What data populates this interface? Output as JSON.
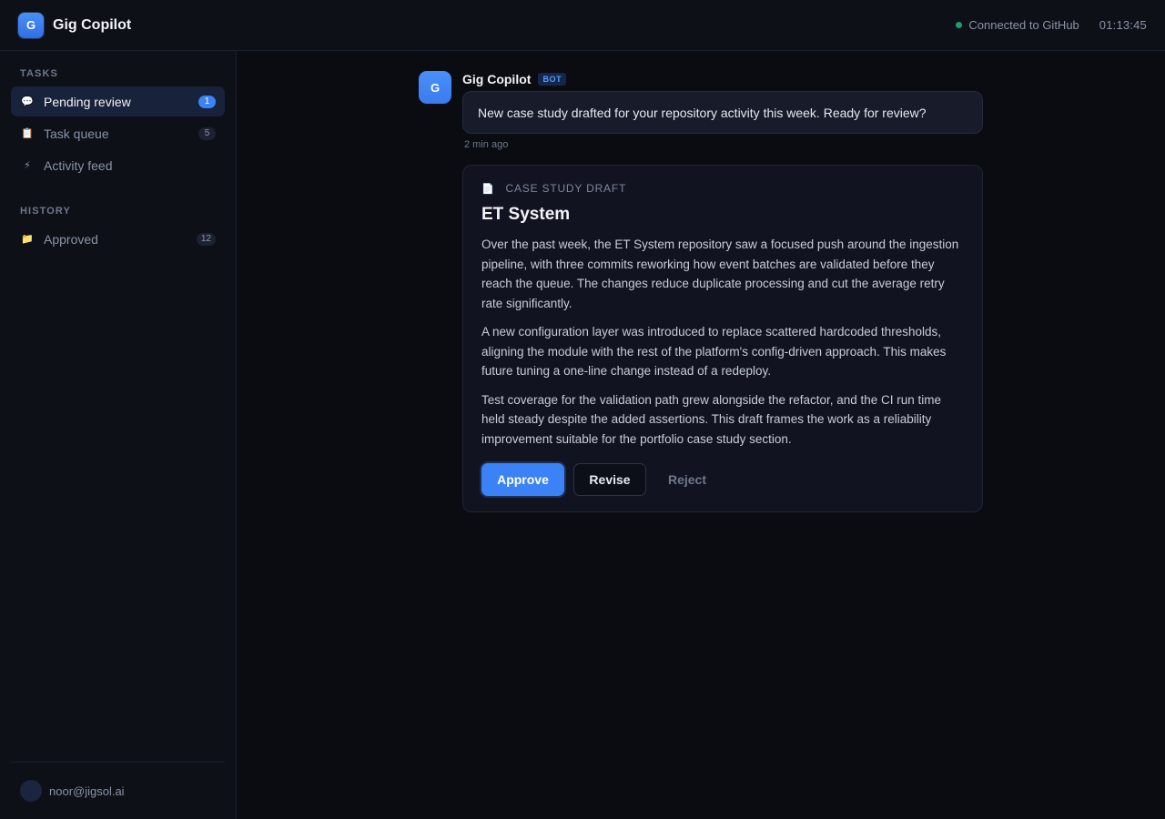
{
  "app": {
    "logo_letter": "G",
    "title": "Gig Copilot",
    "connection_status": "Connected to GitHub",
    "clock": "01:13:45"
  },
  "sidebar": {
    "tasks_label": "TASKS",
    "history_label": "HISTORY",
    "tasks": [
      {
        "icon": "speech-bubble-icon",
        "glyph": "💬",
        "label": "Pending review",
        "count": "1",
        "active": true
      },
      {
        "icon": "clipboard-icon",
        "glyph": "📋",
        "label": "Task queue",
        "count": "5",
        "active": false
      },
      {
        "icon": "lightning-icon",
        "glyph": "⚡",
        "label": "Activity feed",
        "count": null,
        "active": false
      }
    ],
    "history": [
      {
        "icon": "folder-icon",
        "glyph": "📁",
        "label": "Approved",
        "count": "12",
        "active": false
      }
    ],
    "user_email": "noor@jigsol.ai"
  },
  "message": {
    "avatar_letter": "G",
    "sender": "Gig Copilot",
    "badge": "BOT",
    "text": "New case study drafted for your repository activity this week. Ready for review?",
    "time": "2 min ago"
  },
  "draft_card": {
    "kicker": "CASE STUDY DRAFT",
    "title": "ET System",
    "paragraphs": [
      "Over the past week, the ET System repository saw a focused push around the ingestion pipeline, with three commits reworking how event batches are validated before they reach the queue. The changes reduce duplicate processing and cut the average retry rate significantly.",
      "A new configuration layer was introduced to replace scattered hardcoded thresholds, aligning the module with the rest of the platform's config-driven approach. This makes future tuning a one-line change instead of a redeploy.",
      "Test coverage for the validation path grew alongside the refactor, and the CI run time held steady despite the added assertions. This draft frames the work as a reliability improvement suitable for the portfolio case study section."
    ],
    "approve_label": "Approve",
    "revise_label": "Revise",
    "reject_label": "Reject"
  },
  "colors": {
    "accent": "#3b82f6",
    "status_connected": "#1f9d6b",
    "background": "#0a0c12"
  }
}
